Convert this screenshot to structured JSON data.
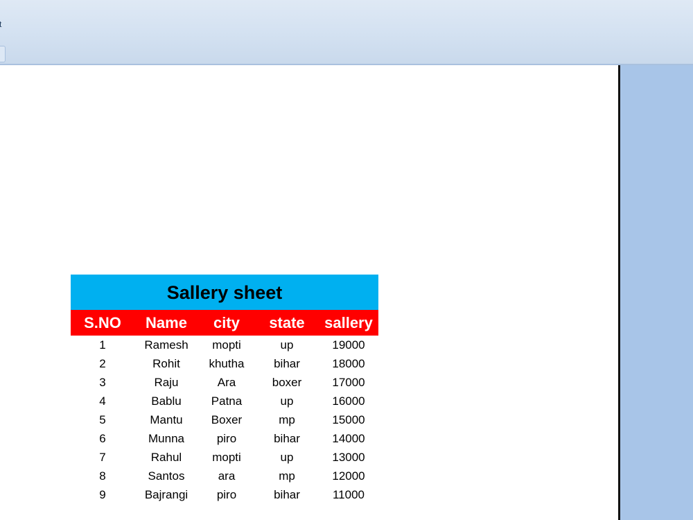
{
  "ribbon": {
    "fragment_text": "t"
  },
  "sheet": {
    "title": "Sallery sheet",
    "columns": [
      "S.NO",
      "Name",
      "city",
      "state",
      "sallery"
    ],
    "rows": [
      [
        "1",
        "Ramesh",
        "mopti",
        "up",
        "19000"
      ],
      [
        "2",
        "Rohit",
        "khutha",
        "bihar",
        "18000"
      ],
      [
        "3",
        "Raju",
        "Ara",
        "boxer",
        "17000"
      ],
      [
        "4",
        "Bablu",
        "Patna",
        "up",
        "16000"
      ],
      [
        "5",
        "Mantu",
        "Boxer",
        "mp",
        "15000"
      ],
      [
        "6",
        "Munna",
        "piro",
        "bihar",
        "14000"
      ],
      [
        "7",
        "Rahul",
        "mopti",
        "up",
        "13000"
      ],
      [
        "8",
        "Santos",
        "ara",
        "mp",
        "12000"
      ],
      [
        "9",
        "Bajrangi",
        "piro",
        "bihar",
        "11000"
      ]
    ]
  },
  "colors": {
    "title_background": "#00b0f0",
    "header_background": "#ff0000",
    "header_text": "#ffffff",
    "workspace_background": "#a8c5e8"
  }
}
